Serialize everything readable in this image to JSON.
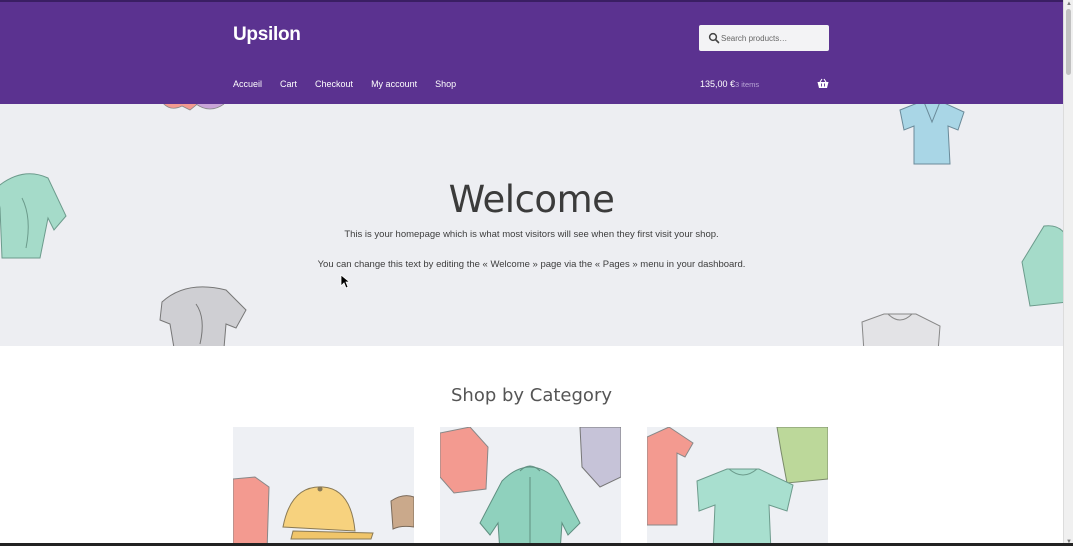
{
  "header": {
    "site_title": "Upsilon",
    "search": {
      "placeholder": "Search products…"
    },
    "nav": [
      "Accueil",
      "Cart",
      "Checkout",
      "My account",
      "Shop"
    ],
    "cart": {
      "total": "135,00 €",
      "count": "3 items"
    }
  },
  "hero": {
    "title": "Welcome",
    "line1": "This is your homepage which is what most visitors will see when they first visit your shop.",
    "line2": "You can change this text by editing the « Welcome » page via the « Pages » menu in your dashboard."
  },
  "category_section": {
    "title": "Shop by Category",
    "categories": [
      {
        "name": "accessories-image"
      },
      {
        "name": "hoodies-image"
      },
      {
        "name": "tshirts-image"
      }
    ]
  },
  "colors": {
    "header_bg": "#5b3290",
    "hero_bg": "#edeef2",
    "text": "#333333"
  }
}
